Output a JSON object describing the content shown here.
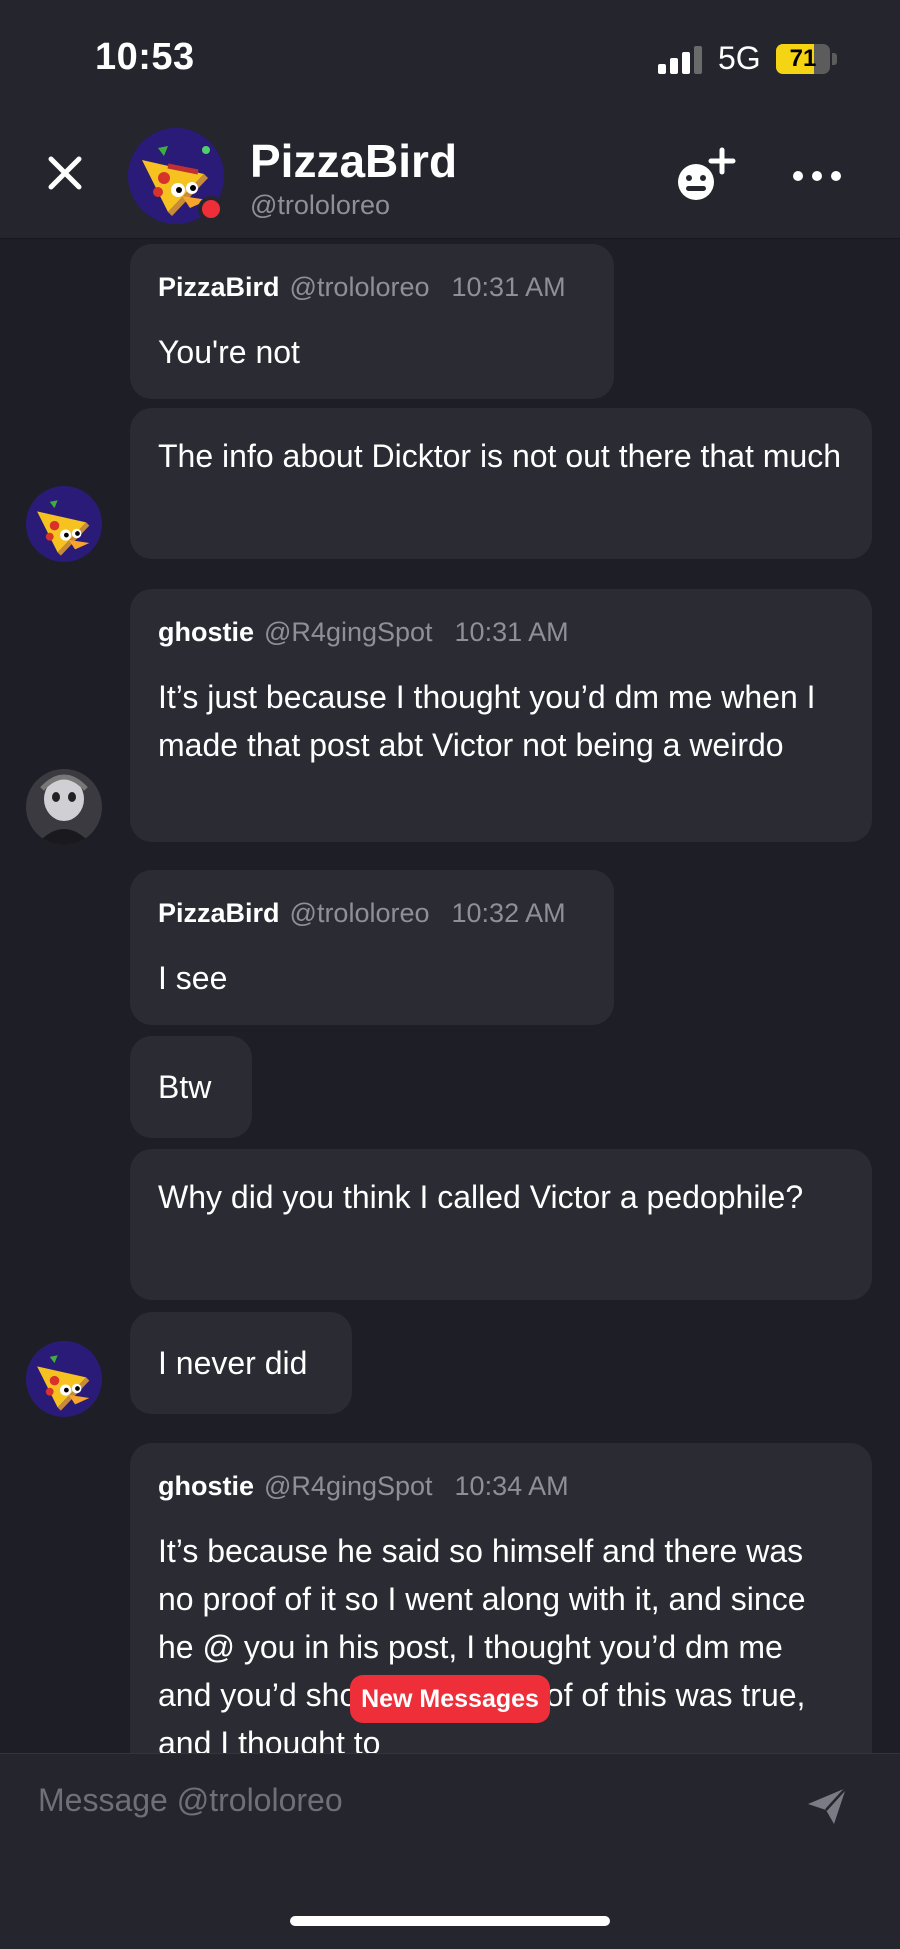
{
  "status": {
    "time": "10:53",
    "network": "5G",
    "battery": "71",
    "battery_level": 0.71
  },
  "header": {
    "name": "PizzaBird",
    "handle": "@trololoreo"
  },
  "messages": [
    {
      "author": "PizzaBird",
      "handle": "@trololoreo",
      "time": "10:31 AM",
      "text": "You're not"
    },
    {
      "text": "The info about Dicktor is not out there that much"
    },
    {
      "author": "ghostie",
      "handle": "@R4gingSpot",
      "time": "10:31 AM",
      "text": "It’s just because I thought you’d dm me when I made that post abt Victor not being a weirdo"
    },
    {
      "author": "PizzaBird",
      "handle": "@trololoreo",
      "time": "10:32 AM",
      "text": "I see"
    },
    {
      "text": "Btw"
    },
    {
      "text": "Why did you think I called Victor a pedophile?"
    },
    {
      "text": "I never did"
    },
    {
      "author": "ghostie",
      "handle": "@R4gingSpot",
      "time": "10:34 AM",
      "text": "It’s because he said so himself and there was no proof of it so I went along with it, and since he @ you in his post, I thought you’d dm me and you’d show me like proof of this was true, and I thought to"
    }
  ],
  "new_messages_label": "New Messages",
  "composer": {
    "placeholder": "Message @trololoreo"
  },
  "colors": {
    "background": "#1e1f26",
    "bubble": "#2a2b33",
    "accent_red": "#ee2f3a",
    "battery_yellow": "#f5d414"
  },
  "icons": [
    "close-icon",
    "add-friend-icon",
    "more-icon",
    "send-icon"
  ]
}
